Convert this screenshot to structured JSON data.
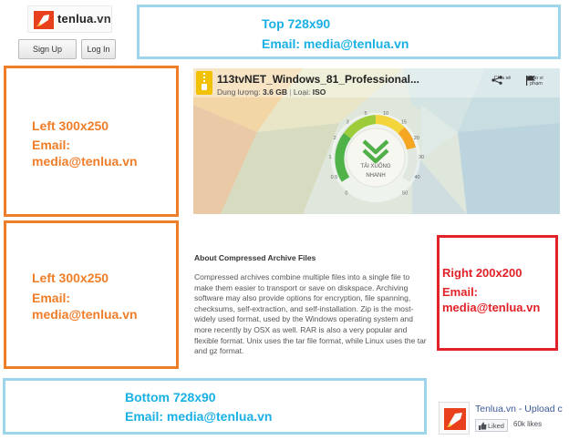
{
  "header": {
    "logo_text": "tenlua",
    "logo_ext": ".vn",
    "sign_up_label": "Sign Up",
    "log_in_label": "Log In"
  },
  "ads": {
    "top": {
      "line1": "Top 728x90",
      "line2": "Email: media@tenlua.vn"
    },
    "left1": {
      "line1": "Left 300x250",
      "line2": "Email:",
      "line3": "media@tenlua.vn"
    },
    "left2": {
      "line1": "Left 300x250",
      "line2": "Email:",
      "line3": "media@tenlua.vn"
    },
    "right": {
      "line1": "Right 200x200",
      "line2": "Email:",
      "line3": "media@tenlua.vn"
    },
    "bottom": {
      "line1": "Bottom 728x90",
      "line2": "Email: media@tenlua.vn"
    },
    "colors": {
      "blue": "#19b0e5",
      "orange": "#f07d28",
      "red": "#e12228"
    }
  },
  "file": {
    "name": "113tvNET_Windows_81_Professional...",
    "size_label": "Dung lượng:",
    "size_value": "3.6 GB",
    "type_label": "Loại:",
    "type_value": "ISO",
    "share_label": "Chia sẻ",
    "report_label": "Báo vi phạm",
    "download_line1": "TẢI XUỐNG",
    "download_line2": "NHANH",
    "speed_marks": [
      "0",
      "0.5",
      "1",
      "2",
      "3",
      "5",
      "10",
      "15",
      "20",
      "30",
      "40",
      "50"
    ]
  },
  "article": {
    "title": "About Compressed Archive Files",
    "body": "Compressed archives combine multiple files into a single file to make them easier to transport or save on diskspace. Archiving software may also provide options for encryption, file spanning, checksums, self-extraction, and self-installation. Zip is the most-widely used format, used by the Windows operating system and more recently by OSX as well. RAR is also a very popular and flexible format. Unix uses the tar file format, while Linux uses the tar and gz format."
  },
  "facebook": {
    "page_name": "Tenlua.vn - Upload c",
    "liked_label": "Liked",
    "likes_count": "60k likes"
  }
}
